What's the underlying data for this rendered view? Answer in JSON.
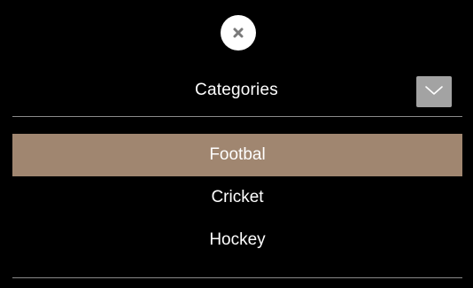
{
  "menu": {
    "close_icon": "close-icon",
    "toggle_icon": "chevron-down-icon",
    "title": "Categories",
    "items": [
      {
        "label": "Footbal",
        "active": true
      },
      {
        "label": "Cricket",
        "active": false
      },
      {
        "label": "Hockey",
        "active": false
      }
    ]
  },
  "colors": {
    "background": "#000000",
    "active_item": "#a08670",
    "toggle_button": "#a3a3a3",
    "close_button": "#ffffff",
    "close_glyph": "#7a7a7a",
    "divider": "#8a8a8a",
    "text": "#ffffff"
  }
}
